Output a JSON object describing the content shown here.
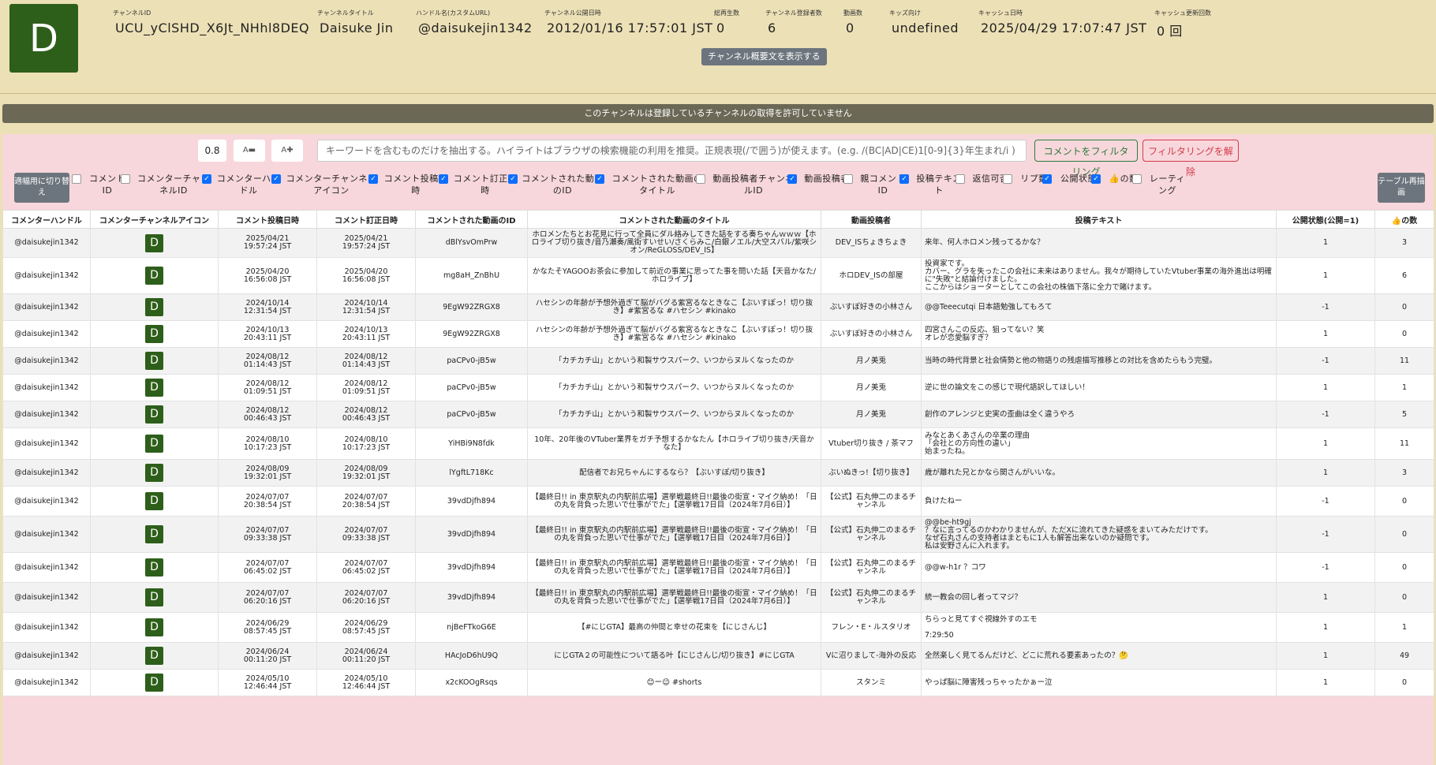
{
  "channel": {
    "avatar_letter": "D",
    "fields": [
      {
        "key": "チャンネルID",
        "value": "UCU_yClSHD_X6Jt_NHhl8DEQ"
      },
      {
        "key": "チャンネルタイトル",
        "value": "Daisuke Jin"
      },
      {
        "key": "ハンドル名(カスタムURL)",
        "value": "@daisukejin1342"
      },
      {
        "key": "チャンネル公開日時",
        "value": "2012/01/16 17:57:01 JST"
      },
      {
        "key": "総再生数",
        "value": "0"
      },
      {
        "key": "チャンネル登録者数",
        "value": "6"
      },
      {
        "key": "動画数",
        "value": "0"
      },
      {
        "key": "キッズ向け",
        "value": "undefined"
      },
      {
        "key": "キャッシュ日時",
        "value": "2025/04/29 17:07:47 JST"
      },
      {
        "key": "キャッシュ更新回数",
        "value": "0 回"
      }
    ],
    "desc_button": "チャンネル概要文を表示する"
  },
  "notice": "このチャンネルは登録しているチャンネルの取得を許可していません",
  "toolbar": {
    "zoom": "0.8",
    "font_down": "A▬",
    "font_up": "A✚",
    "search_placeholder": "キーワードを含むものだけを抽出する。ハイライトはブラウザの検索機能の利用を推奨。正規表現(/で囲う)が使えます。(e.g. /(BC|AD|CE)1[0-9]{3}年生まれ/i )",
    "filter_button": "コメントをフィルタリング",
    "clear_button": "フィルタリングを解除"
  },
  "toggles": {
    "wrap_button": "適幅用に切り替え",
    "redraw_button": "テーブル再描画",
    "items": [
      {
        "label": "コメントID",
        "on": false
      },
      {
        "label": "コメンターチャンネルID",
        "on": false
      },
      {
        "label": "コメンターハンドル",
        "on": true
      },
      {
        "label": "コメンターチャンネルアイコン",
        "on": true
      },
      {
        "label": "コメント投稿日時",
        "on": true
      },
      {
        "label": "コメント訂正日時",
        "on": true
      },
      {
        "label": "コメントされた動画のID",
        "on": true
      },
      {
        "label": "コメントされた動画のタイトル",
        "on": true
      },
      {
        "label": "動画投稿者チャンネルID",
        "on": false
      },
      {
        "label": "動画投稿者",
        "on": true
      },
      {
        "label": "親コメントID",
        "on": false
      },
      {
        "label": "投稿テキスト",
        "on": true
      },
      {
        "label": "返信可否",
        "on": false
      },
      {
        "label": "リプ数",
        "on": false
      },
      {
        "label": "公開状態",
        "on": true
      },
      {
        "label": "👍の数",
        "on": true
      },
      {
        "label": "レーティング",
        "on": false
      }
    ]
  },
  "table": {
    "headers": [
      "コメンターハンドル",
      "コメンターチャンネルアイコン",
      "コメント投稿日時",
      "コメント訂正日時",
      "コメントされた動画のID",
      "コメントされた動画のタイトル",
      "動画投稿者",
      "投稿テキスト",
      "公開状態(公開=1)",
      "👍の数"
    ],
    "rows": [
      {
        "handle": "@daisukejin1342",
        "icon": "D",
        "posted": "2025/04/21 19:57:24 JST",
        "edited": "2025/04/21 19:57:24 JST",
        "video_id": "dBlYsvOmPrw",
        "title": "ホロメンたちとお花見に行って全員にダル絡みしてきた話をする奏ちゃんｗｗｗ【ホロライブ切り抜き/音乃瀬奏/風街すいせい/さくらみこ/白銀ノエル/大空スバル/紫咲シオン/ReGLOSS/DEV_IS】",
        "uploader": "DEV_ISちょきちょき",
        "text": "来年、何人ホロメン残ってるかな？",
        "public": "1",
        "likes": "3"
      },
      {
        "handle": "@daisukejin1342",
        "icon": "D",
        "posted": "2025/04/20 16:56:08 JST",
        "edited": "2025/04/20 16:56:08 JST",
        "video_id": "mg8aH_ZnBhU",
        "title": "かなたそYAGOOお茶会に参加して前近の事業に思ってた事を問いた話【天音かなた/ホロライブ】",
        "uploader": "ホロDEV_ISの部屋",
        "text": "投資家です。\nカバー、グラを失ったこの会社に未来はありません。我々が期待していたVtuber事業の海外進出は明確に\"失敗\"と結論付けました。\nここからはショーターとしてこの会社の株価下落に全力で賭けます。",
        "public": "1",
        "likes": "6"
      },
      {
        "handle": "@daisukejin1342",
        "icon": "D",
        "posted": "2024/10/14 12:31:54 JST",
        "edited": "2024/10/14 12:31:54 JST",
        "video_id": "9EgW92ZRGX8",
        "title": "ハセシンの年齢が予想外過ぎて脳がバグる紫宮るなときなこ【ぶいすぽっ！切り抜き】#紫宮るな #ハセシン #kinako",
        "uploader": "ぶいすぽ好きの小林さん",
        "text": "@@Teeecutqi 日本語勉強してもろて",
        "public": "-1",
        "likes": "0"
      },
      {
        "handle": "@daisukejin1342",
        "icon": "D",
        "posted": "2024/10/13 20:43:11 JST",
        "edited": "2024/10/13 20:43:11 JST",
        "video_id": "9EgW92ZRGX8",
        "title": "ハセシンの年齢が予想外過ぎて脳がバグる紫宮るなときなこ【ぶいすぽっ！切り抜き】#紫宮るな #ハセシン #kinako",
        "uploader": "ぶいすぽ好きの小林さん",
        "text": "四宮さんこの反応、狙ってない？笑\nオレが恋愛脳すぎ？",
        "public": "1",
        "likes": "0"
      },
      {
        "handle": "@daisukejin1342",
        "icon": "D",
        "posted": "2024/08/12 01:14:43 JST",
        "edited": "2024/08/12 01:14:43 JST",
        "video_id": "paCPv0-jB5w",
        "title": "「カチカチ山」とかいう和製サウスパーク、いつからヌルくなったのか",
        "uploader": "月ノ美兎",
        "text": "当時の時代背景と社会情勢と他の物語りの残虐描写推移との対比を含めたらもう完璧。",
        "public": "-1",
        "likes": "11"
      },
      {
        "handle": "@daisukejin1342",
        "icon": "D",
        "posted": "2024/08/12 01:09:51 JST",
        "edited": "2024/08/12 01:09:51 JST",
        "video_id": "paCPv0-jB5w",
        "title": "「カチカチ山」とかいう和製サウスパーク、いつからヌルくなったのか",
        "uploader": "月ノ美兎",
        "text": "逆に世の論文をこの感じで現代語訳してほしい！",
        "public": "1",
        "likes": "1"
      },
      {
        "handle": "@daisukejin1342",
        "icon": "D",
        "posted": "2024/08/12 00:46:43 JST",
        "edited": "2024/08/12 00:46:43 JST",
        "video_id": "paCPv0-jB5w",
        "title": "「カチカチ山」とかいう和製サウスパーク、いつからヌルくなったのか",
        "uploader": "月ノ美兎",
        "text": "創作のアレンジと史実の歪曲は全く違うやろ",
        "public": "-1",
        "likes": "5"
      },
      {
        "handle": "@daisukejin1342",
        "icon": "D",
        "posted": "2024/08/10 10:17:23 JST",
        "edited": "2024/08/10 10:17:23 JST",
        "video_id": "YiHBi9N8fdk",
        "title": "10年、20年後のVTuber業界をガチ予想するかなたん【ホロライブ切り抜き/天音かなた】",
        "uploader": "Vtuber切り抜き / 茶マフ",
        "text": "みなとあくあさんの卒業の理由\n「会社との方向性の違い」\n始まったね。",
        "public": "1",
        "likes": "11"
      },
      {
        "handle": "@daisukejin1342",
        "icon": "D",
        "posted": "2024/08/09 19:32:01 JST",
        "edited": "2024/08/09 19:32:01 JST",
        "video_id": "lYgftL718Kc",
        "title": "配信者でお兄ちゃんにするなら？【ぶいすぽ/切り抜き】",
        "uploader": "ぶいぬきっ!【切り抜き】",
        "text": "歳が離れた兄とかなら関さんがいいな。",
        "public": "1",
        "likes": "3"
      },
      {
        "handle": "@daisukejin1342",
        "icon": "D",
        "posted": "2024/07/07 20:38:54 JST",
        "edited": "2024/07/07 20:38:54 JST",
        "video_id": "39vdDjfh894",
        "title": "【最終日!! in 東京駅丸の内駅前広場】選挙戦最終日!!最後の街宣・マイク納め！「日の丸を背負った思いで仕事がでた」【選挙戦17日目（2024年7月6日）】",
        "uploader": "【公式】石丸伸二のまるチャンネル",
        "text": "負けたねー",
        "public": "-1",
        "likes": "0"
      },
      {
        "handle": "@daisukejin1342",
        "icon": "D",
        "posted": "2024/07/07 09:33:38 JST",
        "edited": "2024/07/07 09:33:38 JST",
        "video_id": "39vdDjfh894",
        "title": "【最終日!! in 東京駅丸の内駅前広場】選挙戦最終日!!最後の街宣・マイク納め！「日の丸を背負った思いで仕事がでた」【選挙戦17日目（2024年7月6日）】",
        "uploader": "【公式】石丸伸二のまるチャンネル",
        "text": "@@be-ht9gj\n？なに言ってるのかわかりませんが、ただXに流れてきた疑惑をまいてみただけです。\nなぜ石丸さんの支持者はまともに1人も解答出来ないのか疑問です。\n私は安野さんに入れます。",
        "public": "-1",
        "likes": "0"
      },
      {
        "handle": "@daisukejin1342",
        "icon": "D",
        "posted": "2024/07/07 06:45:02 JST",
        "edited": "2024/07/07 06:45:02 JST",
        "video_id": "39vdDjfh894",
        "title": "【最終日!! in 東京駅丸の内駅前広場】選挙戦最終日!!最後の街宣・マイク納め！「日の丸を背負った思いで仕事がでた」【選挙戦17日目（2024年7月6日）】",
        "uploader": "【公式】石丸伸二のまるチャンネル",
        "text": "@@w-h1r ？コワ",
        "public": "-1",
        "likes": "0"
      },
      {
        "handle": "@daisukejin1342",
        "icon": "D",
        "posted": "2024/07/07 06:20:16 JST",
        "edited": "2024/07/07 06:20:16 JST",
        "video_id": "39vdDjfh894",
        "title": "【最終日!! in 東京駅丸の内駅前広場】選挙戦最終日!!最後の街宣・マイク納め！「日の丸を背負った思いで仕事がでた」【選挙戦17日目（2024年7月6日）】",
        "uploader": "【公式】石丸伸二のまるチャンネル",
        "text": "統一教会の回し者ってマジ？",
        "public": "1",
        "likes": "0"
      },
      {
        "handle": "@daisukejin1342",
        "icon": "D",
        "posted": "2024/06/29 08:57:45 JST",
        "edited": "2024/06/29 08:57:45 JST",
        "video_id": "njBeFTkoG6E",
        "title": "【#にじGTA】最高の仲間と幸せの花束を【にじさんじ】",
        "uploader": "フレン・E・ルスタリオ",
        "text": "ちらっと見てすぐ視線外すのエモ\n\n7:29:50",
        "public": "1",
        "likes": "1"
      },
      {
        "handle": "@daisukejin1342",
        "icon": "D",
        "posted": "2024/06/24 00:11:20 JST",
        "edited": "2024/06/24 00:11:20 JST",
        "video_id": "HAcJoD6hU9Q",
        "title": "にじGTA２の可能性について語る叶【にじさんじ/切り抜き】#にじGTA",
        "uploader": "Vに沼りまして-海外の反応",
        "text": "全然楽しく見てるんだけど、どこに荒れる要素あったの？🤔",
        "public": "1",
        "likes": "49"
      },
      {
        "handle": "@daisukejin1342",
        "icon": "D",
        "posted": "2024/05/10 12:46:44 JST",
        "edited": "2024/05/10 12:46:44 JST",
        "video_id": "x2cKOOgRsqs",
        "title": "😊ー😉 #shorts",
        "uploader": "スタンミ",
        "text": "やっぱ脳に障害残っちゃったかぁー泣",
        "public": "1",
        "likes": "0"
      }
    ]
  },
  "colors": {
    "avatar_green": "#2e5f1a",
    "page_bg": "#ece0b6",
    "panel_bg": "#f7d7dc",
    "notice_bg": "#6b6856"
  }
}
